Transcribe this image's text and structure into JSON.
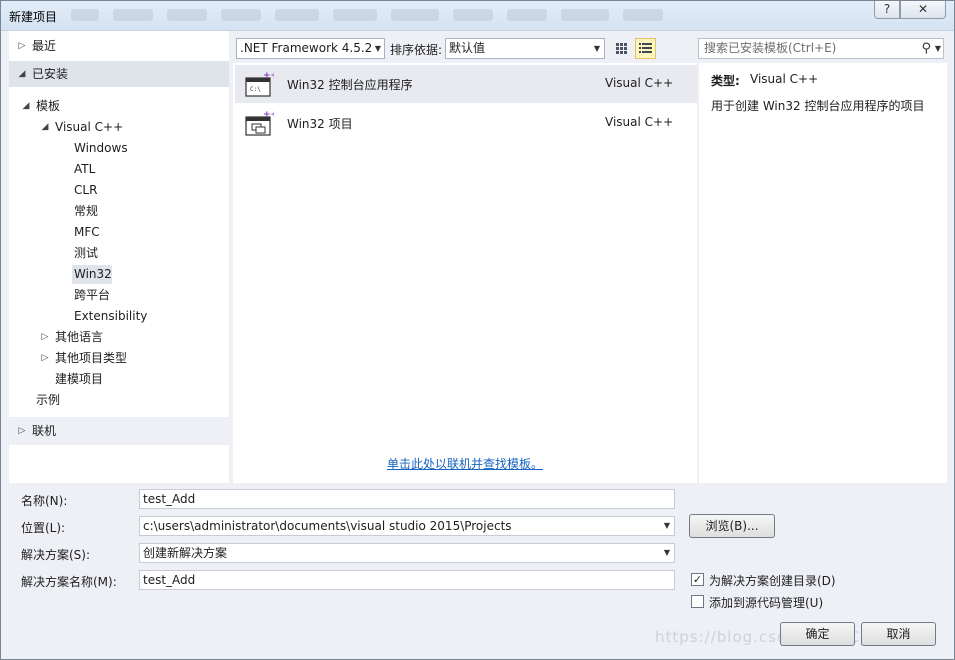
{
  "window": {
    "title": "新建项目",
    "help_label": "?",
    "close_label": "✕"
  },
  "left_tree": {
    "recent": "最近",
    "installed": "已安装",
    "templates": "模板",
    "visual_cpp": "Visual C++",
    "cpp_children": [
      "Windows",
      "ATL",
      "CLR",
      "常规",
      "MFC",
      "测试",
      "Win32",
      "跨平台",
      "Extensibility"
    ],
    "other_languages": "其他语言",
    "other_project_types": "其他项目类型",
    "modeling_projects": "建模项目",
    "samples": "示例",
    "online": "联机"
  },
  "toolbar": {
    "framework": ".NET Framework 4.5.2",
    "sort_label": "排序依据:",
    "sort_value": "默认值",
    "search_placeholder": "搜索已安装模板(Ctrl+E)"
  },
  "templates": [
    {
      "name": "Win32 控制台应用程序",
      "lang": "Visual C++",
      "icon": "console-app-icon"
    },
    {
      "name": "Win32 项目",
      "lang": "Visual C++",
      "icon": "win32-project-icon"
    }
  ],
  "online_link": "单击此处以联机并查找模板。",
  "description": {
    "type_label": "类型:",
    "type_value": "Visual C++",
    "text": "用于创建 Win32 控制台应用程序的项目"
  },
  "form": {
    "name_label": "名称(N):",
    "name_value": "test_Add",
    "location_label": "位置(L):",
    "location_value": "c:\\users\\administrator\\documents\\visual studio 2015\\Projects",
    "solution_label": "解决方案(S):",
    "solution_value": "创建新解决方案",
    "solution_name_label": "解决方案名称(M):",
    "solution_name_value": "test_Add",
    "browse_label": "浏览(B)...",
    "create_dir_label": "为解决方案创建目录(D)",
    "create_dir_checked": true,
    "source_control_label": "添加到源代码管理(U)",
    "source_control_checked": false,
    "ok_label": "确定",
    "cancel_label": "取消"
  },
  "watermark": "https://blog.csdn.net/CC_MUSE"
}
